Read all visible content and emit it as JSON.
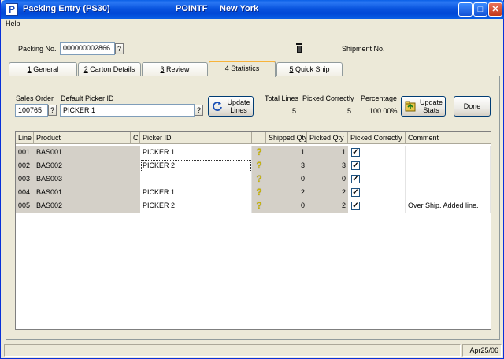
{
  "window": {
    "title": "Packing Entry (PS30)",
    "company": "POINTF",
    "location": "New York"
  },
  "titlebar": {
    "app_icon": "P",
    "minimize": "_",
    "maximize": "□",
    "close": "✕"
  },
  "menu": {
    "help": "Help"
  },
  "header": {
    "packing_no_label": "Packing No.",
    "packing_no_value": "000000002866",
    "trash_icon": "trash-icon",
    "shipment_no_label": "Shipment No."
  },
  "tabs": [
    {
      "num": "1",
      "label": " General"
    },
    {
      "num": "2",
      "label": " Carton Details"
    },
    {
      "num": "3",
      "label": " Review"
    },
    {
      "num": "4",
      "label": " Statistics"
    },
    {
      "num": "5",
      "label": " Quick Ship"
    }
  ],
  "stats": {
    "sales_order_label": "Sales Order",
    "sales_order_value": "100765",
    "default_picker_label": "Default Picker ID",
    "default_picker_value": "PICKER 1",
    "update_lines_label_1": "Update",
    "update_lines_label_2": "Lines",
    "total_lines_label": "Total Lines",
    "total_lines_value": "5",
    "picked_correctly_label": "Picked Correctly",
    "picked_correctly_value": "5",
    "percentage_label": "Percentage",
    "percentage_value": "100.00%",
    "update_stats_label_1": "Update",
    "update_stats_label_2": "Stats",
    "done_label": "Done",
    "q": "?"
  },
  "grid": {
    "columns": [
      "Line",
      "Product",
      "C",
      "Picker ID",
      "",
      "Shipped Qty",
      "Picked Qty",
      "Picked Correctly",
      "Comment"
    ],
    "qmark": "?",
    "check": "✓",
    "rows": [
      {
        "line": "001",
        "product": "BAS001",
        "c": "",
        "picker": "PICKER 1",
        "shipped": "1",
        "picked": "1",
        "correct": true,
        "comment": ""
      },
      {
        "line": "002",
        "product": "BAS002",
        "c": "",
        "picker": "PICKER 2",
        "shipped": "3",
        "picked": "3",
        "correct": true,
        "comment": ""
      },
      {
        "line": "003",
        "product": "BAS003",
        "c": "",
        "picker": "",
        "shipped": "0",
        "picked": "0",
        "correct": true,
        "comment": ""
      },
      {
        "line": "004",
        "product": "BAS001",
        "c": "",
        "picker": "PICKER 1",
        "shipped": "2",
        "picked": "2",
        "correct": true,
        "comment": ""
      },
      {
        "line": "005",
        "product": "BAS002",
        "c": "",
        "picker": "PICKER 2",
        "shipped": "0",
        "picked": "2",
        "correct": true,
        "comment": "Over Ship.  Added line."
      }
    ]
  },
  "status": {
    "date": "Apr25/06"
  }
}
